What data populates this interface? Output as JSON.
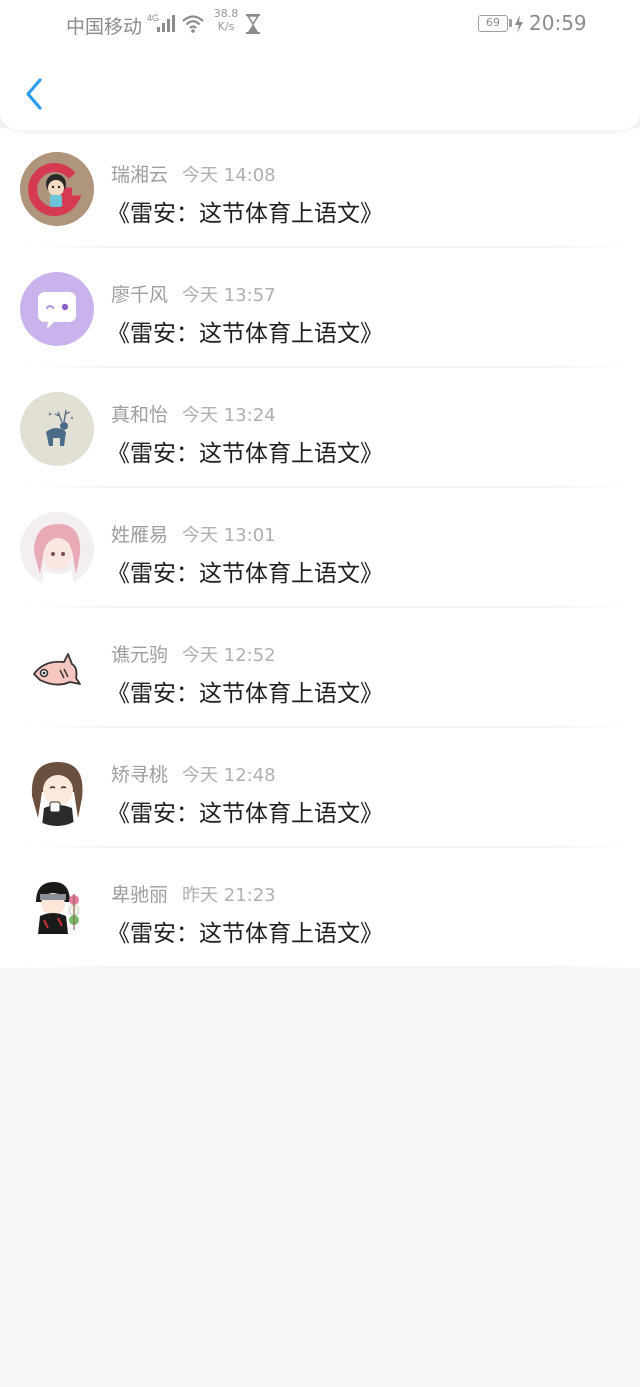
{
  "status_bar": {
    "carrier": "中国移动",
    "network_type": "4G",
    "net_speed_value": "38.8",
    "net_speed_unit": "K/s",
    "battery_level": "69",
    "time": "20:59",
    "icons": [
      "signal-icon",
      "wifi-icon",
      "hourglass-icon",
      "battery-icon",
      "charging-icon"
    ]
  },
  "header": {
    "back_icon": "chevron-left-icon",
    "accent_color": "#2a9cf0"
  },
  "messages": [
    {
      "name": "瑞湘云",
      "time": "今天 14:08",
      "text": "《雷安：这节体育上语文》"
    },
    {
      "name": "廖千风",
      "time": "今天 13:57",
      "text": "《雷安：这节体育上语文》"
    },
    {
      "name": "真和怡",
      "time": "今天 13:24",
      "text": "《雷安：这节体育上语文》"
    },
    {
      "name": "姓雁易",
      "time": "今天 13:01",
      "text": "《雷安：这节体育上语文》"
    },
    {
      "name": "谯元驹",
      "time": "今天 12:52",
      "text": "《雷安：这节体育上语文》"
    },
    {
      "name": "矫寻桃",
      "time": "今天 12:48",
      "text": "《雷安：这节体育上语文》"
    },
    {
      "name": "卑驰丽",
      "time": "昨天 21:23",
      "text": "《雷安：这节体育上语文》"
    }
  ]
}
